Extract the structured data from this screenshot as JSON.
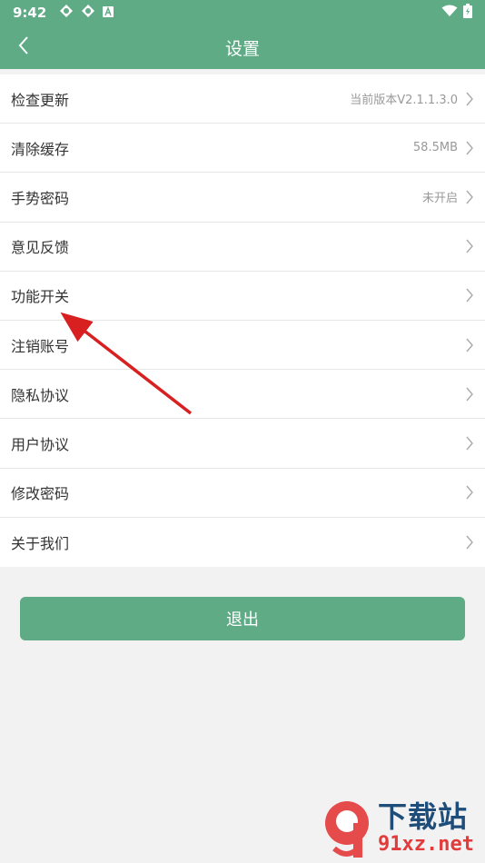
{
  "status_bar": {
    "time": "9:42",
    "left_icons": [
      "notification-icon",
      "notification-icon",
      "app-icon"
    ],
    "right_icons": [
      "wifi-icon",
      "battery-icon"
    ]
  },
  "header": {
    "title": "设置",
    "back_icon": "chevron-left-icon"
  },
  "menu": {
    "items": [
      {
        "label": "检查更新",
        "value": "当前版本V2.1.1.3.0"
      },
      {
        "label": "清除缓存",
        "value": "58.5MB"
      },
      {
        "label": "手势密码",
        "value": "未开启"
      },
      {
        "label": "意见反馈",
        "value": ""
      },
      {
        "label": "功能开关",
        "value": ""
      },
      {
        "label": "注销账号",
        "value": ""
      },
      {
        "label": "隐私协议",
        "value": ""
      },
      {
        "label": "用户协议",
        "value": ""
      },
      {
        "label": "修改密码",
        "value": ""
      },
      {
        "label": "关于我们",
        "value": ""
      }
    ]
  },
  "logout": {
    "label": "退出"
  },
  "colors": {
    "primary": "#5eab85",
    "background": "#f2f2f2",
    "annotation_arrow": "#d92020"
  },
  "watermark": {
    "title": "下载站",
    "site": "91xz.net"
  }
}
